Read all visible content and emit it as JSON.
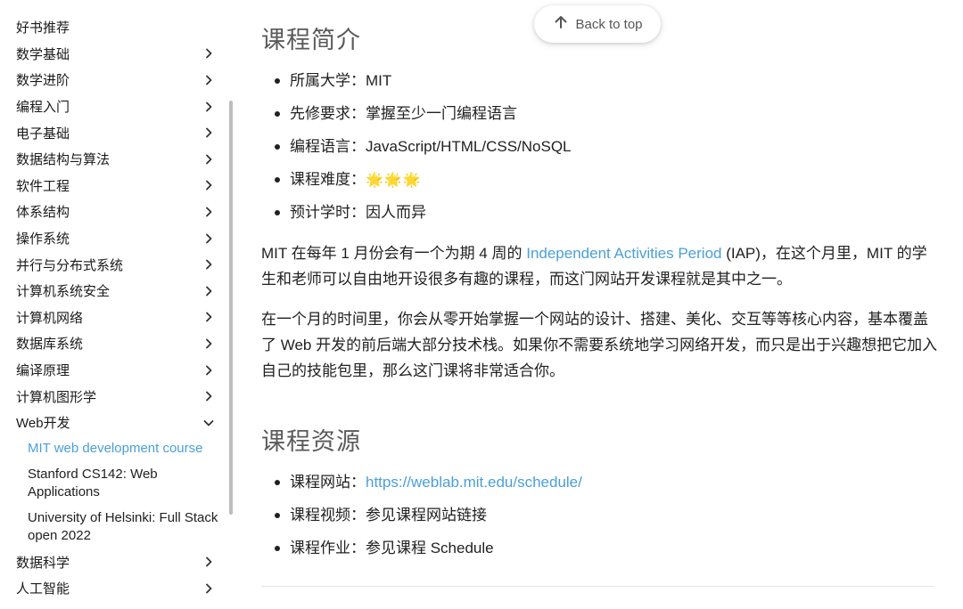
{
  "sidebar": {
    "items": [
      {
        "label": "好书推荐",
        "chevron": false
      },
      {
        "label": "数学基础",
        "chevron": "right"
      },
      {
        "label": "数学进阶",
        "chevron": "right"
      },
      {
        "label": "编程入门",
        "chevron": "right"
      },
      {
        "label": "电子基础",
        "chevron": "right"
      },
      {
        "label": "数据结构与算法",
        "chevron": "right"
      },
      {
        "label": "软件工程",
        "chevron": "right"
      },
      {
        "label": "体系结构",
        "chevron": "right"
      },
      {
        "label": "操作系统",
        "chevron": "right"
      },
      {
        "label": "并行与分布式系统",
        "chevron": "right"
      },
      {
        "label": "计算机系统安全",
        "chevron": "right"
      },
      {
        "label": "计算机网络",
        "chevron": "right"
      },
      {
        "label": "数据库系统",
        "chevron": "right"
      },
      {
        "label": "编译原理",
        "chevron": "right"
      },
      {
        "label": "计算机图形学",
        "chevron": "right"
      },
      {
        "label": "Web开发",
        "chevron": "down"
      }
    ],
    "web_subitems": [
      {
        "label": "MIT web development course",
        "active": true
      },
      {
        "label": "Stanford CS142: Web Applications",
        "active": false
      },
      {
        "label": "University of Helsinki: Full Stack open 2022",
        "active": false
      }
    ],
    "after_items": [
      {
        "label": "数据科学",
        "chevron": "right"
      },
      {
        "label": "人工智能",
        "chevron": "right"
      }
    ]
  },
  "back_to_top": {
    "label": "Back to top",
    "icon": "arrow-up-icon"
  },
  "intro": {
    "heading": "课程简介",
    "facts": [
      {
        "key": "所属大学：",
        "value": "MIT"
      },
      {
        "key": "先修要求：",
        "value": "掌握至少一门编程语言"
      },
      {
        "key": "编程语言：",
        "value": "JavaScript/HTML/CSS/NoSQL"
      },
      {
        "key": "课程难度：",
        "value": "🌟🌟🌟"
      },
      {
        "key": "预计学时：",
        "value": "因人而异"
      }
    ],
    "para1_before": "MIT 在每年 1 月份会有一个为期 4 周的 ",
    "para1_link": "Independent Activities Period",
    "para1_after": " (IAP)，在这个月里，MIT 的学生和老师可以自由地开设很多有趣的课程，而这门网站开发课程就是其中之一。",
    "para2": "在一个月的时间里，你会从零开始掌握一个网站的设计、搭建、美化、交互等等核心内容，基本覆盖了 Web 开发的前后端大部分技术栈。如果你不需要系统地学习网络开发，而只是出于兴趣想把它加入自己的技能包里，那么这门课将非常适合你。"
  },
  "resources": {
    "heading": "课程资源",
    "website_key": "课程网站：",
    "website_url": "https://weblab.mit.edu/schedule/",
    "video_key": "课程视频：",
    "video_value": "参见课程网站链接",
    "assignment_key": "课程作业：",
    "assignment_value": "参见课程 Schedule"
  },
  "colors": {
    "link": "#4a9fd8",
    "heading": "#5a5a5a",
    "text": "#212121",
    "stars": "#f3c623"
  }
}
